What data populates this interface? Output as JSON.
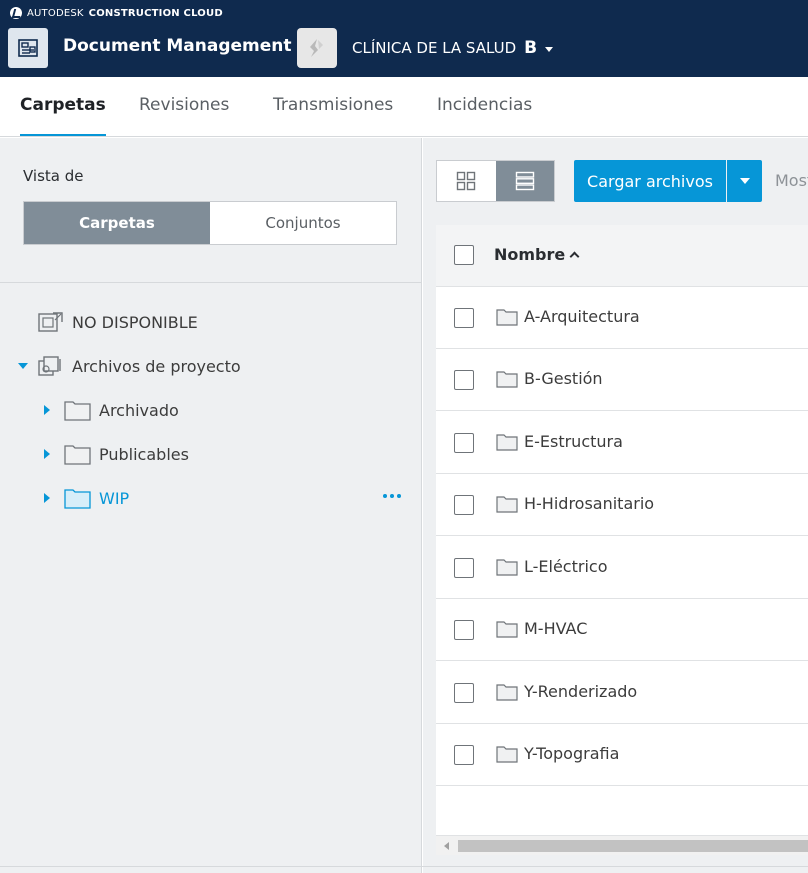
{
  "brand": {
    "autodesk": "AUTODESK",
    "product": "CONSTRUCTION CLOUD"
  },
  "app": {
    "title": "Document Management"
  },
  "project": {
    "name": "CLÍNICA DE LA SALUD",
    "badge": "B"
  },
  "tabs": [
    {
      "label": "Carpetas",
      "active": true
    },
    {
      "label": "Revisiones",
      "active": false
    },
    {
      "label": "Transmisiones",
      "active": false
    },
    {
      "label": "Incidencias",
      "active": false
    }
  ],
  "sidebar": {
    "view_label": "Vista de",
    "segments": {
      "folders": "Carpetas",
      "sets": "Conjuntos"
    },
    "tree": {
      "unavailable": "NO DISPONIBLE",
      "project_files": "Archivos de proyecto",
      "children": [
        {
          "label": "Archivado"
        },
        {
          "label": "Publicables"
        },
        {
          "label": "WIP"
        }
      ]
    }
  },
  "toolbar": {
    "upload_label": "Cargar archivos",
    "show_label": "Mostrar"
  },
  "table": {
    "header_name": "Nombre",
    "rows": [
      {
        "name": "A-Arquitectura"
      },
      {
        "name": "B-Gestión"
      },
      {
        "name": "E-Estructura"
      },
      {
        "name": "H-Hidrosanitario"
      },
      {
        "name": "L-Eléctrico"
      },
      {
        "name": "M-HVAC"
      },
      {
        "name": "Y-Renderizado"
      },
      {
        "name": "Y-Topografia"
      }
    ]
  },
  "colors": {
    "header_bg": "#0f2a4e",
    "accent": "#0696d7",
    "segment_active": "#808d98"
  }
}
